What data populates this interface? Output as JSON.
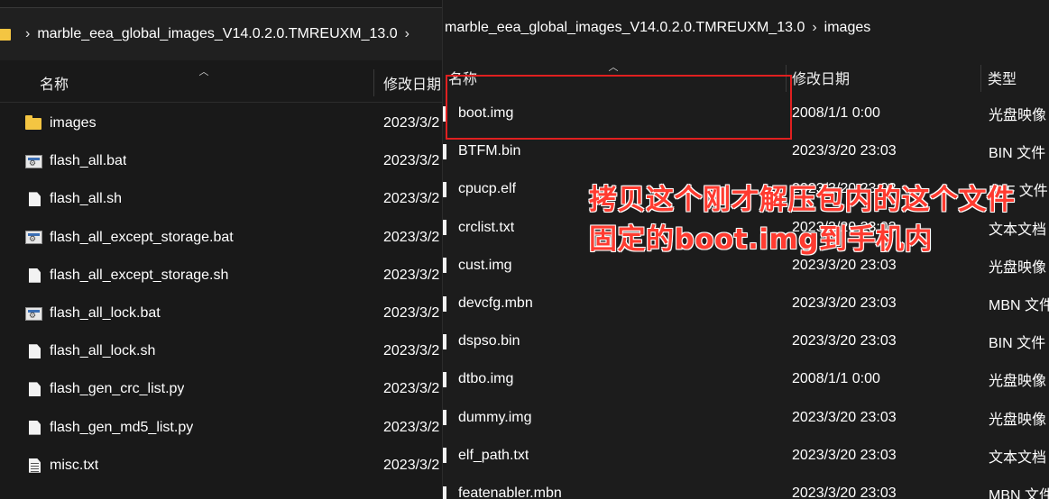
{
  "left_window": {
    "breadcrumb": "marble_eea_global_images_V14.0.2.0.TMREUXM_13.0",
    "columns": {
      "name": "名称",
      "modified": "修改日期"
    },
    "rows": [
      {
        "icon": "folder-icon",
        "name": "images",
        "modified": "2023/3/2"
      },
      {
        "icon": "batch-file-icon",
        "name": "flash_all.bat",
        "modified": "2023/3/2"
      },
      {
        "icon": "file-icon",
        "name": "flash_all.sh",
        "modified": "2023/3/2"
      },
      {
        "icon": "batch-file-icon",
        "name": "flash_all_except_storage.bat",
        "modified": "2023/3/2"
      },
      {
        "icon": "file-icon",
        "name": "flash_all_except_storage.sh",
        "modified": "2023/3/2"
      },
      {
        "icon": "batch-file-icon",
        "name": "flash_all_lock.bat",
        "modified": "2023/3/2"
      },
      {
        "icon": "file-icon",
        "name": "flash_all_lock.sh",
        "modified": "2023/3/2"
      },
      {
        "icon": "file-icon",
        "name": "flash_gen_crc_list.py",
        "modified": "2023/3/2"
      },
      {
        "icon": "file-icon",
        "name": "flash_gen_md5_list.py",
        "modified": "2023/3/2"
      },
      {
        "icon": "text-file-icon",
        "name": "misc.txt",
        "modified": "2023/3/2"
      }
    ]
  },
  "right_window": {
    "breadcrumb": [
      "marble_eea_global_images_V14.0.2.0.TMREUXM_13.0",
      "images"
    ],
    "columns": {
      "name": "名称",
      "modified": "修改日期",
      "type": "类型"
    },
    "rows": [
      {
        "name": "boot.img",
        "modified": "2008/1/1 0:00",
        "type": "光盘映像"
      },
      {
        "name": "BTFM.bin",
        "modified": "2023/3/20 23:03",
        "type": "BIN 文件"
      },
      {
        "name": "cpucp.elf",
        "modified": "2023/3/20 23:03",
        "type": "ELF 文件"
      },
      {
        "name": "crclist.txt",
        "modified": "2023/3/20 23:03",
        "type": "文本文档"
      },
      {
        "name": "cust.img",
        "modified": "2023/3/20 23:03",
        "type": "光盘映像"
      },
      {
        "name": "devcfg.mbn",
        "modified": "2023/3/20 23:03",
        "type": "MBN 文件"
      },
      {
        "name": "dspso.bin",
        "modified": "2023/3/20 23:03",
        "type": "BIN 文件"
      },
      {
        "name": "dtbo.img",
        "modified": "2008/1/1 0:00",
        "type": "光盘映像"
      },
      {
        "name": "dummy.img",
        "modified": "2023/3/20 23:03",
        "type": "光盘映像"
      },
      {
        "name": "elf_path.txt",
        "modified": "2023/3/20 23:03",
        "type": "文本文档"
      },
      {
        "name": "featenabler.mbn",
        "modified": "2023/3/20 23:03",
        "type": "MBN 文件"
      }
    ]
  },
  "annotation": {
    "line1": "拷贝这个刚才解压包内的这个文件",
    "line2": "固定的boot.img到手机内",
    "color": "#ff3b30"
  }
}
